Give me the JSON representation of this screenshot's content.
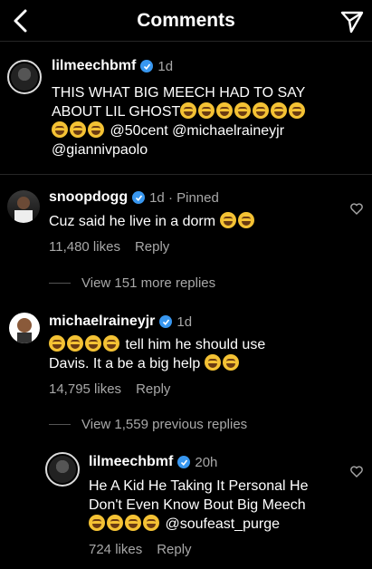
{
  "header": {
    "title": "Comments",
    "back_icon": "chevron-left-icon",
    "send_icon": "paper-plane-icon"
  },
  "caption": {
    "username": "lilmeechbmf",
    "time": "1d",
    "line1": "THIS WHAT BIG MEECH HAD TO SAY",
    "line2": "ABOUT LIL GHOST",
    "line3": "@50cent @michaelraineyjr",
    "line4": "@giannivpaolo"
  },
  "comments": [
    {
      "username": "snoopdogg",
      "meta": "1d · Pinned",
      "text": "Cuz said he live in a dorm",
      "likes": "11,480 likes",
      "reply": "Reply",
      "view_replies": "View 151 more replies"
    },
    {
      "username": "michaelraineyjr",
      "meta": "1d",
      "text1": "tell him he should use",
      "text2": "Davis. It a be a big help",
      "likes": "14,795 likes",
      "reply": "Reply",
      "view_replies": "View 1,559 previous replies"
    }
  ],
  "reply": {
    "username": "lilmeechbmf",
    "meta": "20h",
    "line1": "He A Kid He Taking It Personal He",
    "line2": "Don't Even Know Bout Big Meech",
    "line3": "@soufeast_purge",
    "likes": "724 likes",
    "reply": "Reply"
  },
  "colors": {
    "verified": "#3897f0",
    "muted": "#a8a8a8",
    "background": "#000000"
  }
}
